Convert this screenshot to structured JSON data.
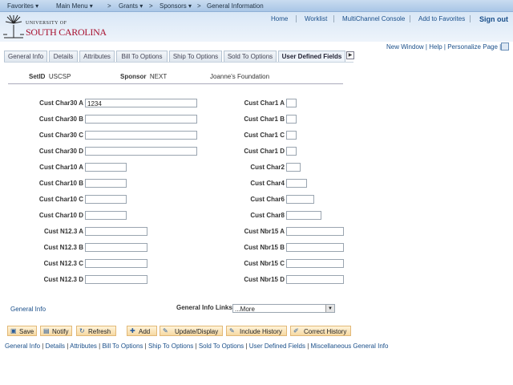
{
  "nav": {
    "favorites": "Favorites ▾",
    "main_menu": "Main Menu ▾",
    "grants": "Grants ▾",
    "sponsors": "Sponsors ▾",
    "page": "General Information",
    "sep": ">"
  },
  "header": {
    "home": "Home",
    "worklist": "Worklist",
    "console": "MultiChannel Console",
    "add_fav": "Add to Favorites",
    "signout": "Sign out",
    "logo_line1": "UNIVERSITY OF",
    "logo_line2": "SOUTH CAROLINA"
  },
  "pagebar": {
    "new_window": "New Window",
    "help": "Help",
    "personalize": "Personalize Page"
  },
  "tabs": [
    "General Info",
    "Details",
    "Attributes",
    "Bill To Options",
    "Ship To Options",
    "Sold To Options",
    "User Defined Fields"
  ],
  "info": {
    "setid_label": "SetID",
    "setid": "USCSP",
    "sponsor_label": "Sponsor",
    "sponsor": "NEXT",
    "sponsor_name": "Joanne's Foundation"
  },
  "left_fields": [
    {
      "label": "Cust Char30 A",
      "value": "1234"
    },
    {
      "label": "Cust Char30 B",
      "value": ""
    },
    {
      "label": "Cust Char30 C",
      "value": ""
    },
    {
      "label": "Cust Char30 D",
      "value": ""
    },
    {
      "label": "Cust Char10 A",
      "value": ""
    },
    {
      "label": "Cust Char10 B",
      "value": ""
    },
    {
      "label": "Cust Char10 C",
      "value": ""
    },
    {
      "label": "Cust Char10 D",
      "value": ""
    },
    {
      "label": "Cust N12.3 A",
      "value": ""
    },
    {
      "label": "Cust N12.3 B",
      "value": ""
    },
    {
      "label": "Cust N12.3 C",
      "value": ""
    },
    {
      "label": "Cust N12.3 D",
      "value": ""
    }
  ],
  "right_fields": [
    {
      "label": "Cust Char1 A",
      "value": ""
    },
    {
      "label": "Cust Char1 B",
      "value": ""
    },
    {
      "label": "Cust Char1 C",
      "value": ""
    },
    {
      "label": "Cust Char1 D",
      "value": ""
    },
    {
      "label": "Cust Char2",
      "value": ""
    },
    {
      "label": "Cust Char4",
      "value": ""
    },
    {
      "label": "Cust Char6",
      "value": ""
    },
    {
      "label": "Cust Char8",
      "value": ""
    },
    {
      "label": "Cust Nbr15 A",
      "value": ""
    },
    {
      "label": "Cust Nbr15 B",
      "value": ""
    },
    {
      "label": "Cust Nbr15 C",
      "value": ""
    },
    {
      "label": "Cust Nbr15 D",
      "value": ""
    }
  ],
  "links": {
    "general_info": "General Info",
    "links_label": "General Info Links:",
    "links_value": "...More"
  },
  "buttons": [
    "Save",
    "Notify",
    "Refresh",
    "Add",
    "Update/Display",
    "Include History",
    "Correct History"
  ],
  "bottom_links": [
    "General Info",
    "Details",
    "Attributes",
    "Bill To Options",
    "Ship To Options",
    "Sold To Options",
    "User Defined Fields",
    "Miscellaneous General Info"
  ]
}
